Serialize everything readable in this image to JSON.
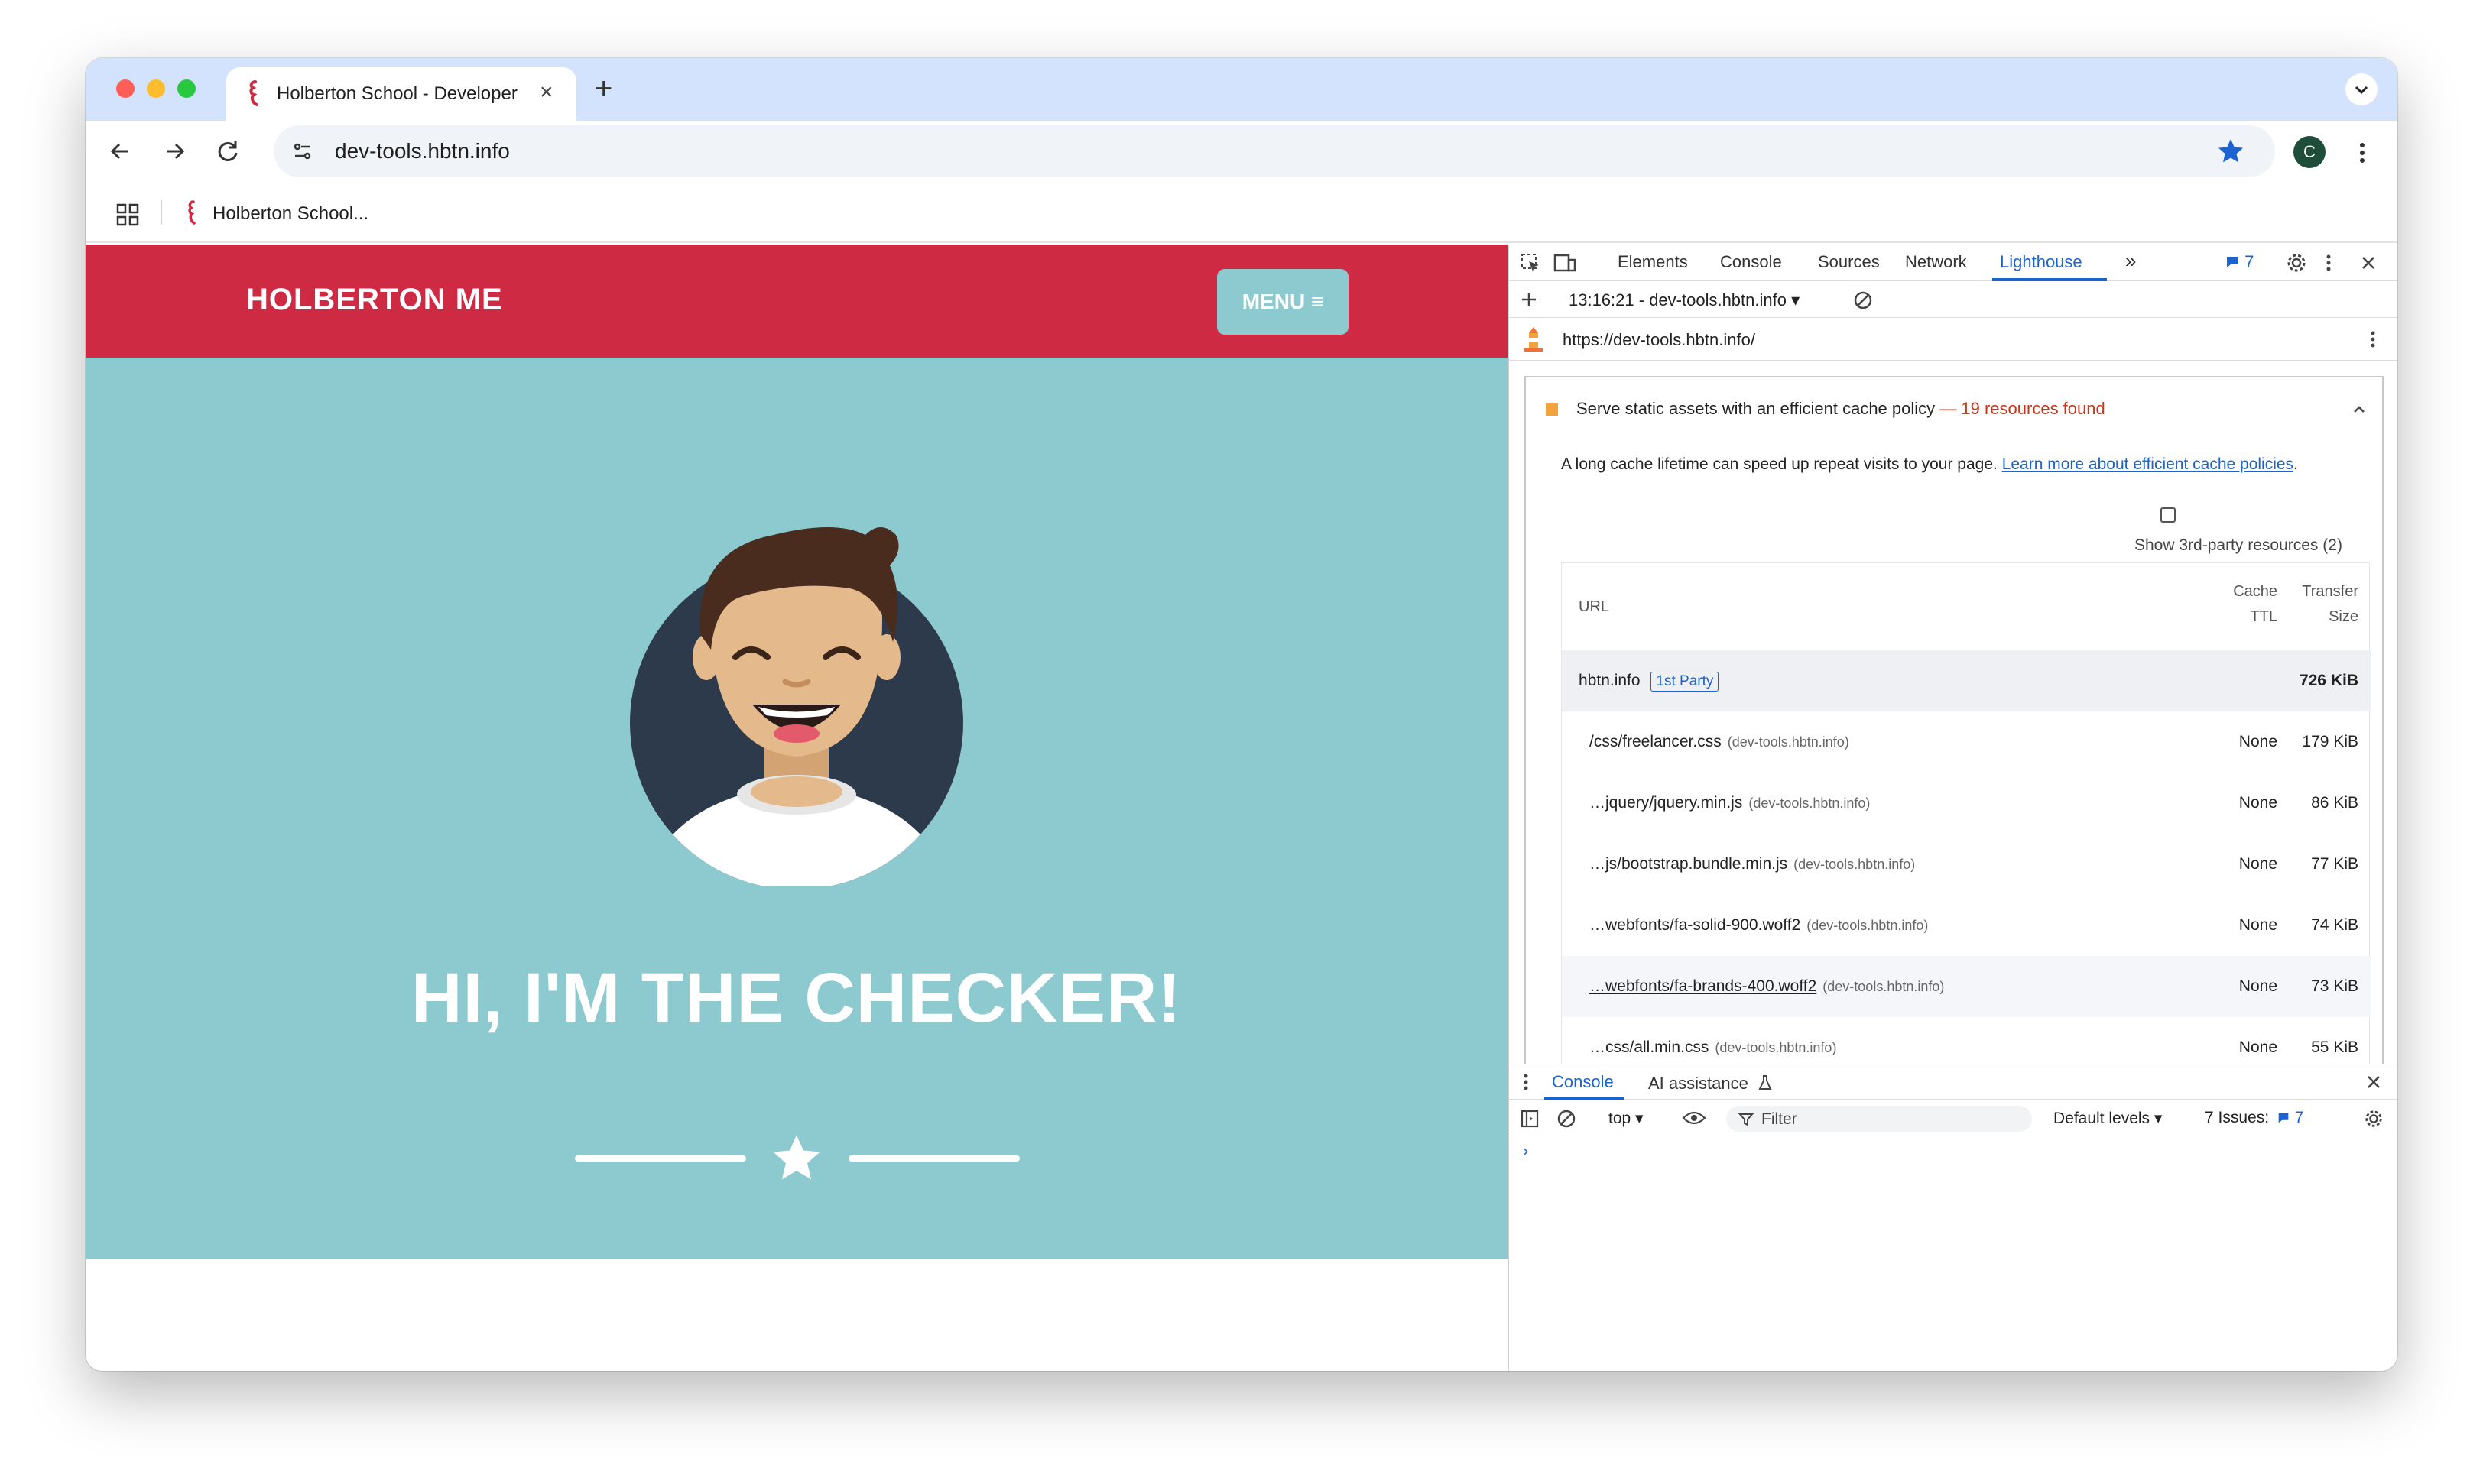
{
  "browser": {
    "tab_title": "Holberton School - Developer",
    "url": "dev-tools.hbtn.info",
    "bookmark_label": "Holberton School...",
    "profile_initial": "C",
    "accent_color": "#1a63d0"
  },
  "page": {
    "brand": "HOLBERTON ME",
    "menu_label": "MENU ≡",
    "hero": "HI, I'M THE CHECKER!",
    "nav_color": "#cf2a44",
    "bg_color": "#8dcacf"
  },
  "devtools": {
    "tabs": [
      "Elements",
      "Console",
      "Sources",
      "Network",
      "Lighthouse"
    ],
    "active_tab": "Lighthouse",
    "issues_count": "7",
    "report_label": "13:16:21 - dev-tools.hbtn.info",
    "report_url": "https://dev-tools.hbtn.info/",
    "audit": {
      "title": "Serve static assets with an efficient cache policy",
      "found": "— 19 resources found",
      "description": "A long cache lifetime can speed up repeat visits to your page.",
      "learn_more": "Learn more about efficient cache policies",
      "third_party_label": "Show 3rd-party resources (2)",
      "headers": {
        "url": "URL",
        "cache_ttl_1": "Cache",
        "cache_ttl_2": "TTL",
        "transfer_1": "Transfer",
        "transfer_2": "Size"
      },
      "group": {
        "name": "hbtn.info",
        "badge": "1st Party",
        "size": "726 KiB"
      },
      "rows": [
        {
          "url": "/css/freelancer.css",
          "domain": "(dev-tools.hbtn.info)",
          "ttl": "None",
          "size": "179 KiB"
        },
        {
          "url": "…jquery/jquery.min.js",
          "domain": "(dev-tools.hbtn.info)",
          "ttl": "None",
          "size": "86 KiB"
        },
        {
          "url": "…js/bootstrap.bundle.min.js",
          "domain": "(dev-tools.hbtn.info)",
          "ttl": "None",
          "size": "77 KiB"
        },
        {
          "url": "…webfonts/fa-solid-900.woff2",
          "domain": "(dev-tools.hbtn.info)",
          "ttl": "None",
          "size": "74 KiB"
        },
        {
          "url": "…webfonts/fa-brands-400.woff2",
          "domain": "(dev-tools.hbtn.info)",
          "ttl": "None",
          "size": "73 KiB"
        },
        {
          "url": "…css/all.min.css",
          "domain": "(dev-tools.hbtn.info)",
          "ttl": "None",
          "size": "55 KiB"
        }
      ]
    },
    "drawer": {
      "tabs": [
        "Console",
        "AI assistance"
      ],
      "context": "top ▾",
      "filter_placeholder": "Filter",
      "levels": "Default levels ▾",
      "issues_label": "7 Issues:",
      "issues_count": "7",
      "prompt": "›"
    }
  }
}
